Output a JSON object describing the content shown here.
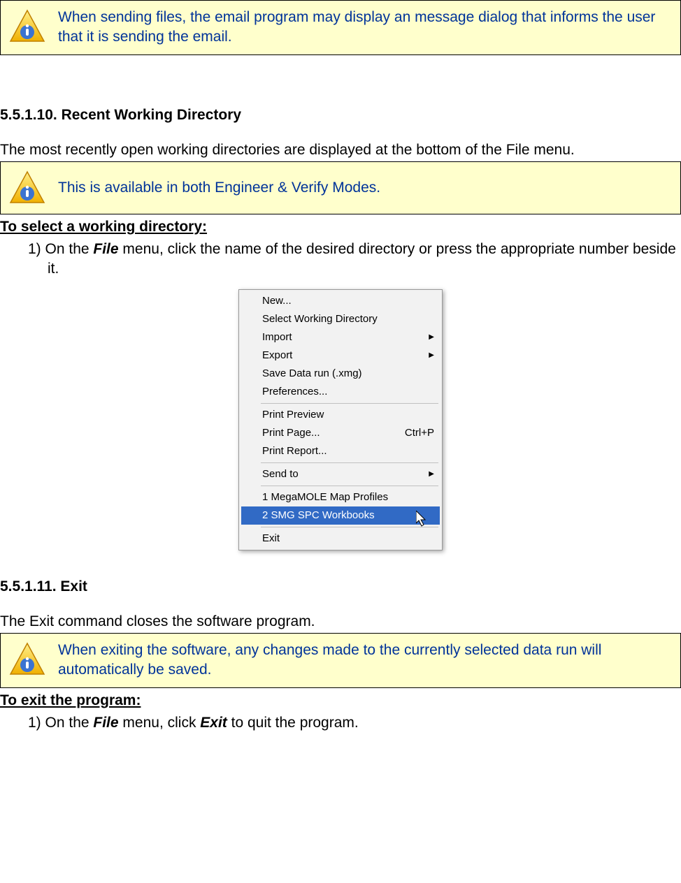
{
  "notes": {
    "note1": "When sending files, the email program may display an message dialog that informs the user that it is sending the email.",
    "note2": "This is available in both Engineer & Verify Modes.",
    "note3": "When exiting the software, any changes made to the currently selected data run will automatically be saved."
  },
  "sections": {
    "s1_heading": "5.5.1.10. Recent Working Directory",
    "s1_intro": "The most recently open working directories are displayed at the bottom of the File menu.",
    "s1_subhead": "To select a working directory:",
    "s1_step_prefix": "1)  On the ",
    "s1_step_bold": "File",
    "s1_step_suffix": " menu, click the name of the desired directory or press the appropriate number beside it.",
    "s2_heading": "5.5.1.11. Exit",
    "s2_intro": "The Exit command closes the software program.",
    "s2_subhead": "To exit the program:",
    "s2_step_prefix": "1)  On the ",
    "s2_step_b1": "File",
    "s2_step_mid": " menu, click ",
    "s2_step_b2": "Exit",
    "s2_step_suffix": " to quit the program."
  },
  "menu": {
    "items": [
      {
        "label": "New...",
        "submenu": false
      },
      {
        "label": "Select Working Directory",
        "submenu": false
      },
      {
        "label": "Import",
        "submenu": true
      },
      {
        "label": "Export",
        "submenu": true
      },
      {
        "label": "Save Data run (.xmg)",
        "submenu": false
      },
      {
        "label": "Preferences...",
        "submenu": false
      },
      {
        "sep": true
      },
      {
        "label": "Print Preview",
        "submenu": false
      },
      {
        "label": "Print Page...",
        "shortcut": "Ctrl+P",
        "submenu": false
      },
      {
        "label": "Print Report...",
        "submenu": false
      },
      {
        "sep": true
      },
      {
        "label": "Send to",
        "submenu": true
      },
      {
        "sep": true
      },
      {
        "label": "1 MegaMOLE Map Profiles",
        "submenu": false
      },
      {
        "label": "2 SMG SPC Workbooks",
        "submenu": false,
        "selected": true
      },
      {
        "sep": true
      },
      {
        "label": "Exit",
        "submenu": false
      }
    ]
  }
}
